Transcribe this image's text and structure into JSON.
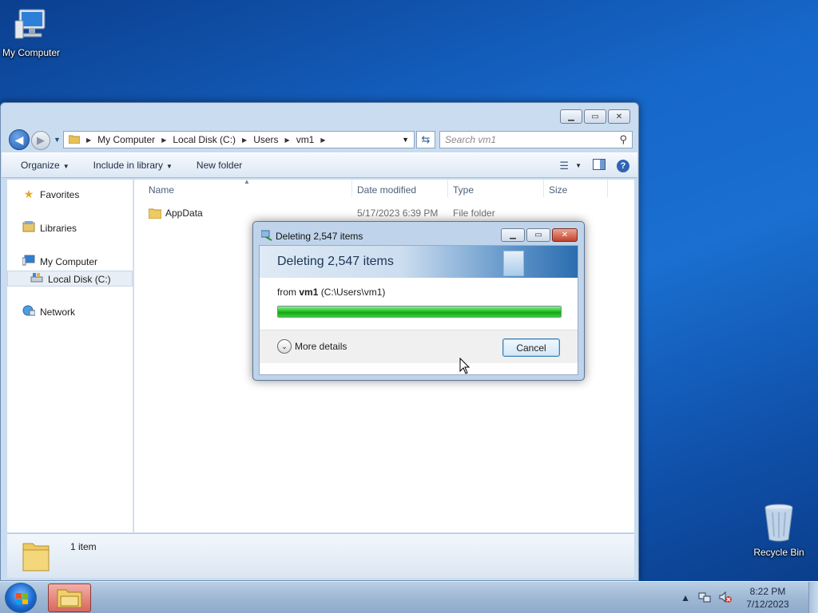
{
  "desktop": {
    "icons": [
      {
        "label": "My Computer",
        "icon": "computer-icon"
      },
      {
        "label": "Recycle Bin",
        "icon": "recycle-bin-icon"
      }
    ]
  },
  "explorer": {
    "breadcrumb": [
      "My Computer",
      "Local Disk (C:)",
      "Users",
      "vm1"
    ],
    "search_placeholder": "Search vm1",
    "toolbar": {
      "organize": "Organize",
      "include_in_library": "Include in library",
      "new_folder": "New folder"
    },
    "nav": {
      "favorites": "Favorites",
      "libraries": "Libraries",
      "my_computer": "My Computer",
      "local_disk": "Local Disk (C:)",
      "network": "Network"
    },
    "columns": {
      "name": "Name",
      "date_modified": "Date modified",
      "type": "Type",
      "size": "Size"
    },
    "rows": [
      {
        "name": "AppData",
        "date_modified": "5/17/2023 6:39 PM",
        "type": "File folder",
        "size": ""
      }
    ],
    "status": "1 item"
  },
  "dialog": {
    "title": "Deleting 2,547 items",
    "header": "Deleting 2,547 items",
    "from_prefix": "from ",
    "from_name": "vm1",
    "from_path": " (C:\\Users\\vm1)",
    "progress_fraction": 1.0,
    "more_details": "More details",
    "cancel": "Cancel",
    "colors": {
      "progress": "#29c329"
    }
  },
  "taskbar": {
    "time": "8:22 PM",
    "date": "7/12/2023"
  }
}
